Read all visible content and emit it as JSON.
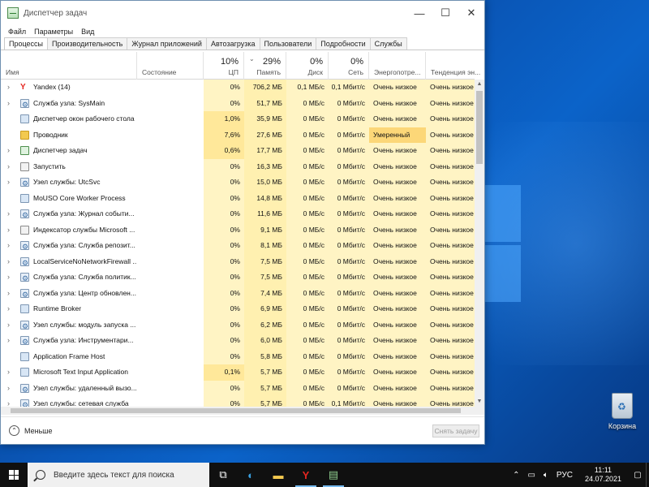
{
  "window": {
    "title": "Диспетчер задач",
    "minimize": "—",
    "maximize": "☐",
    "close": "✕"
  },
  "menu": [
    "Файл",
    "Параметры",
    "Вид"
  ],
  "tabs": [
    "Процессы",
    "Производительность",
    "Журнал приложений",
    "Автозагрузка",
    "Пользователи",
    "Подробности",
    "Службы"
  ],
  "header": {
    "name": "Имя",
    "state": "Состояние",
    "cpu_pct": "10%",
    "cpu": "ЦП",
    "mem_pct": "29%",
    "mem": "Память",
    "disk_pct": "0%",
    "disk": "Диск",
    "net_pct": "0%",
    "net": "Сеть",
    "energy": "Энергопотре...",
    "trend": "Тенденция эн..."
  },
  "rows": [
    {
      "name": "Yandex (14)",
      "icon": "yandex-icon",
      "expand": true,
      "cpu": "0%",
      "mem": "706,2 МБ",
      "disk": "0,1 МБ/с",
      "net": "0,1 Мбит/с",
      "energy": "Очень низкое",
      "trend": "Очень низкое"
    },
    {
      "name": "Служба узла: SysMain",
      "icon": "gear-icon",
      "expand": true,
      "cpu": "0%",
      "mem": "51,7 МБ",
      "disk": "0 МБ/с",
      "net": "0 Мбит/с",
      "energy": "Очень низкое",
      "trend": "Очень низкое"
    },
    {
      "name": "Диспетчер окон рабочего стола",
      "icon": "monitor-icon",
      "expand": false,
      "cpu": "1,0%",
      "mem": "35,9 МБ",
      "disk": "0 МБ/с",
      "net": "0 Мбит/с",
      "energy": "Очень низкое",
      "trend": "Очень низкое"
    },
    {
      "name": "Проводник",
      "icon": "folder-icon",
      "expand": false,
      "cpu": "7,6%",
      "mem": "27,6 МБ",
      "disk": "0 МБ/с",
      "net": "0 Мбит/с",
      "energy": "Умеренный",
      "trend": "Очень низкое"
    },
    {
      "name": "Диспетчер задач",
      "icon": "task-manager-icon",
      "expand": true,
      "cpu": "0,6%",
      "mem": "17,7 МБ",
      "disk": "0 МБ/с",
      "net": "0 Мбит/с",
      "energy": "Очень низкое",
      "trend": "Очень низкое"
    },
    {
      "name": "Запустить",
      "icon": "search-icon",
      "expand": true,
      "cpu": "0%",
      "mem": "16,3 МБ",
      "disk": "0 МБ/с",
      "net": "0 Мбит/с",
      "energy": "Очень низкое",
      "trend": "Очень низкое"
    },
    {
      "name": "Узел службы: UtcSvc",
      "icon": "gear-icon",
      "expand": true,
      "cpu": "0%",
      "mem": "15,0 МБ",
      "disk": "0 МБ/с",
      "net": "0 Мбит/с",
      "energy": "Очень низкое",
      "trend": "Очень низкое"
    },
    {
      "name": "MoUSO Core Worker Process",
      "icon": "monitor-icon",
      "expand": false,
      "cpu": "0%",
      "mem": "14,8 МБ",
      "disk": "0 МБ/с",
      "net": "0 Мбит/с",
      "energy": "Очень низкое",
      "trend": "Очень низкое"
    },
    {
      "name": "Служба узла: Журнал событи...",
      "icon": "gear-icon",
      "expand": true,
      "cpu": "0%",
      "mem": "11,6 МБ",
      "disk": "0 МБ/с",
      "net": "0 Мбит/с",
      "energy": "Очень низкое",
      "trend": "Очень низкое"
    },
    {
      "name": "Индексатор службы Microsoft ...",
      "icon": "search-icon",
      "expand": true,
      "cpu": "0%",
      "mem": "9,1 МБ",
      "disk": "0 МБ/с",
      "net": "0 Мбит/с",
      "energy": "Очень низкое",
      "trend": "Очень низкое"
    },
    {
      "name": "Служба узла: Служба репозит...",
      "icon": "gear-icon",
      "expand": true,
      "cpu": "0%",
      "mem": "8,1 МБ",
      "disk": "0 МБ/с",
      "net": "0 Мбит/с",
      "energy": "Очень низкое",
      "trend": "Очень низкое"
    },
    {
      "name": "LocalServiceNoNetworkFirewall ...",
      "icon": "gear-icon",
      "expand": true,
      "cpu": "0%",
      "mem": "7,5 МБ",
      "disk": "0 МБ/с",
      "net": "0 Мбит/с",
      "energy": "Очень низкое",
      "trend": "Очень низкое"
    },
    {
      "name": "Служба узла: Служба политик...",
      "icon": "gear-icon",
      "expand": true,
      "cpu": "0%",
      "mem": "7,5 МБ",
      "disk": "0 МБ/с",
      "net": "0 Мбит/с",
      "energy": "Очень низкое",
      "trend": "Очень низкое"
    },
    {
      "name": "Служба узла: Центр обновлен...",
      "icon": "gear-icon",
      "expand": true,
      "cpu": "0%",
      "mem": "7,4 МБ",
      "disk": "0 МБ/с",
      "net": "0 Мбит/с",
      "energy": "Очень низкое",
      "trend": "Очень низкое"
    },
    {
      "name": "Runtime Broker",
      "icon": "monitor-icon",
      "expand": true,
      "cpu": "0%",
      "mem": "6,9 МБ",
      "disk": "0 МБ/с",
      "net": "0 Мбит/с",
      "energy": "Очень низкое",
      "trend": "Очень низкое"
    },
    {
      "name": "Узел службы: модуль запуска ...",
      "icon": "gear-icon",
      "expand": true,
      "cpu": "0%",
      "mem": "6,2 МБ",
      "disk": "0 МБ/с",
      "net": "0 Мбит/с",
      "energy": "Очень низкое",
      "trend": "Очень низкое"
    },
    {
      "name": "Служба узла: Инструментари...",
      "icon": "gear-icon",
      "expand": true,
      "cpu": "0%",
      "mem": "6,0 МБ",
      "disk": "0 МБ/с",
      "net": "0 Мбит/с",
      "energy": "Очень низкое",
      "trend": "Очень низкое"
    },
    {
      "name": "Application Frame Host",
      "icon": "monitor-icon",
      "expand": false,
      "cpu": "0%",
      "mem": "5,8 МБ",
      "disk": "0 МБ/с",
      "net": "0 Мбит/с",
      "energy": "Очень низкое",
      "trend": "Очень низкое"
    },
    {
      "name": "Microsoft Text Input Application",
      "icon": "monitor-icon",
      "expand": true,
      "cpu": "0,1%",
      "mem": "5,7 МБ",
      "disk": "0 МБ/с",
      "net": "0 Мбит/с",
      "energy": "Очень низкое",
      "trend": "Очень низкое"
    },
    {
      "name": "Узел службы: удаленный вызо...",
      "icon": "gear-icon",
      "expand": true,
      "cpu": "0%",
      "mem": "5,7 МБ",
      "disk": "0 МБ/с",
      "net": "0 Мбит/с",
      "energy": "Очень низкое",
      "trend": "Очень низкое"
    },
    {
      "name": "Узел службы: сетевая служба",
      "icon": "gear-icon",
      "expand": true,
      "cpu": "0%",
      "mem": "5,7 МБ",
      "disk": "0 МБ/с",
      "net": "0,1 Мбит/с",
      "energy": "Очень низкое",
      "trend": "Очень низкое"
    }
  ],
  "footer": {
    "fewer": "Меньше",
    "end_task": "Снять задачу"
  },
  "desktop": {
    "recycle_bin": "Корзина"
  },
  "taskbar": {
    "search_placeholder": "Введите здесь текст для поиска",
    "lang": "РУС",
    "time": "11:11",
    "date": "24.07.2021"
  },
  "colors": {
    "moderate_energy": "#fcd778",
    "heat_low": "#fff4c4"
  }
}
